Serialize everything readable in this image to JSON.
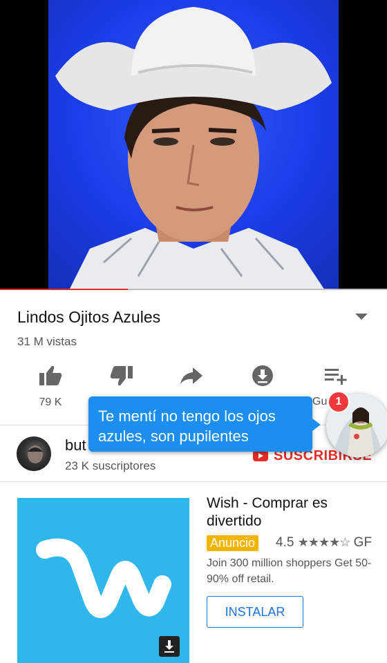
{
  "player": {
    "progress_fraction": 0.33
  },
  "video": {
    "title": "Lindos Ojitos Azules",
    "views": "31 M vistas"
  },
  "actions": [
    {
      "icon": "thumbs-up-icon",
      "label": "79 K"
    },
    {
      "icon": "thumbs-down-icon",
      "label": ""
    },
    {
      "icon": "share-icon",
      "label": ""
    },
    {
      "icon": "download-icon",
      "label": ""
    },
    {
      "icon": "add-to-playlist-icon",
      "label": "Gu"
    }
  ],
  "channel": {
    "name": "but",
    "subscribers": "23 K suscriptores",
    "subscribe_label": "SUSCRIBIRSE"
  },
  "chat": {
    "message": "Te mentí no tengo los ojos azules, son pupilentes",
    "unread_count": "1"
  },
  "ad": {
    "app_name": "Wish - Comprar es divertido",
    "badge": "Anuncio",
    "rating": "4.5",
    "stars": "★★★★☆",
    "rating_suffix": "GF",
    "description": "Join 300 million shoppers Get 50-90% off retail.",
    "install_label": "INSTALAR"
  },
  "colors": {
    "accent_red": "#e52d27",
    "chat_blue": "#1b8ef0",
    "wish_blue": "#2fb7ec",
    "ad_badge": "#f4b400",
    "install_blue": "#1a73e8"
  }
}
